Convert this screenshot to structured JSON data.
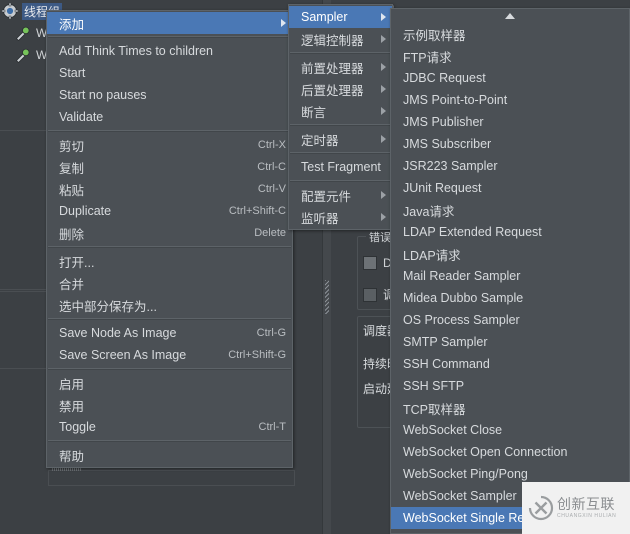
{
  "app": {
    "panel_title": "线程组"
  },
  "tree": {
    "items": [
      {
        "label": "线程组",
        "icon": "gear-icon",
        "selected": true
      },
      {
        "label": "W",
        "icon": "pipette-icon",
        "selected": false
      },
      {
        "label": "W",
        "icon": "pipette-icon",
        "selected": false
      }
    ]
  },
  "background_form": {
    "group1_legend": "错误处…",
    "checkbox1": "De",
    "checkbox2": "调",
    "group2_legend": "调度器",
    "field1": "持续时",
    "field2": "启动延"
  },
  "context_menu": {
    "items": [
      {
        "label": "添加",
        "accel": "",
        "submenu": true,
        "highlight": true
      },
      {
        "sep": true
      },
      {
        "label": "Add Think Times to children",
        "accel": "",
        "submenu": false
      },
      {
        "label": "Start",
        "accel": "",
        "submenu": false
      },
      {
        "label": "Start no pauses",
        "accel": "",
        "submenu": false
      },
      {
        "label": "Validate",
        "accel": "",
        "submenu": false
      },
      {
        "sep": true
      },
      {
        "label": "剪切",
        "accel": "Ctrl-X",
        "submenu": false
      },
      {
        "label": "复制",
        "accel": "Ctrl-C",
        "submenu": false
      },
      {
        "label": "粘贴",
        "accel": "Ctrl-V",
        "submenu": false
      },
      {
        "label": "Duplicate",
        "accel": "Ctrl+Shift-C",
        "submenu": false
      },
      {
        "label": "删除",
        "accel": "Delete",
        "submenu": false
      },
      {
        "sep": true
      },
      {
        "label": "打开...",
        "accel": "",
        "submenu": false
      },
      {
        "label": "合并",
        "accel": "",
        "submenu": false
      },
      {
        "label": "选中部分保存为...",
        "accel": "",
        "submenu": false
      },
      {
        "sep": true
      },
      {
        "label": "Save Node As Image",
        "accel": "Ctrl-G",
        "submenu": false
      },
      {
        "label": "Save Screen As Image",
        "accel": "Ctrl+Shift-G",
        "submenu": false
      },
      {
        "sep": true
      },
      {
        "label": "启用",
        "accel": "",
        "submenu": false
      },
      {
        "label": "禁用",
        "accel": "",
        "submenu": false
      },
      {
        "label": "Toggle",
        "accel": "Ctrl-T",
        "submenu": false
      },
      {
        "sep": true
      },
      {
        "label": "帮助",
        "accel": "",
        "submenu": false
      }
    ]
  },
  "add_submenu": {
    "items": [
      {
        "label": "Sampler",
        "submenu": true,
        "highlight": true
      },
      {
        "label": "逻辑控制器",
        "submenu": true
      },
      {
        "sep": true
      },
      {
        "label": "前置处理器",
        "submenu": true
      },
      {
        "label": "后置处理器",
        "submenu": true
      },
      {
        "label": "断言",
        "submenu": true
      },
      {
        "sep": true
      },
      {
        "label": "定时器",
        "submenu": true
      },
      {
        "sep": true
      },
      {
        "label": "Test Fragment",
        "submenu": true
      },
      {
        "sep": true
      },
      {
        "label": "配置元件",
        "submenu": true
      },
      {
        "label": "监听器",
        "submenu": true
      }
    ]
  },
  "sampler_submenu": {
    "scroll_up": "scroll-up-arrow",
    "items": [
      {
        "label": "示例取样器",
        "highlight": false
      },
      {
        "label": "FTP请求",
        "highlight": false
      },
      {
        "label": "JDBC Request",
        "highlight": false
      },
      {
        "label": "JMS Point-to-Point",
        "highlight": false
      },
      {
        "label": "JMS Publisher",
        "highlight": false
      },
      {
        "label": "JMS Subscriber",
        "highlight": false
      },
      {
        "label": "JSR223 Sampler",
        "highlight": false
      },
      {
        "label": "JUnit Request",
        "highlight": false
      },
      {
        "label": "Java请求",
        "highlight": false
      },
      {
        "label": "LDAP Extended Request",
        "highlight": false
      },
      {
        "label": "LDAP请求",
        "highlight": false
      },
      {
        "label": "Mail Reader Sampler",
        "highlight": false
      },
      {
        "label": "Midea Dubbo Sample",
        "highlight": false
      },
      {
        "label": "OS Process Sampler",
        "highlight": false
      },
      {
        "label": "SMTP Sampler",
        "highlight": false
      },
      {
        "label": "SSH Command",
        "highlight": false
      },
      {
        "label": "SSH SFTP",
        "highlight": false
      },
      {
        "label": "TCP取样器",
        "highlight": false
      },
      {
        "label": "WebSocket Close",
        "highlight": false
      },
      {
        "label": "WebSocket Open Connection",
        "highlight": false
      },
      {
        "label": "WebSocket Ping/Pong",
        "highlight": false
      },
      {
        "label": "WebSocket Sampler",
        "highlight": false
      },
      {
        "label": "WebSocket Single Request",
        "highlight": true
      }
    ]
  },
  "watermark": {
    "cn": "创新互联",
    "en": "CHUANGXIN HULIAN",
    "logo": "circle-x-logo"
  },
  "colors": {
    "window_bg": "#3c4044",
    "menu_bg": "#4b5055",
    "menu_border": "#5d6368",
    "highlight": "#4a78b5",
    "text": "#d7dadd",
    "tree_selected": "#3d5a85"
  }
}
